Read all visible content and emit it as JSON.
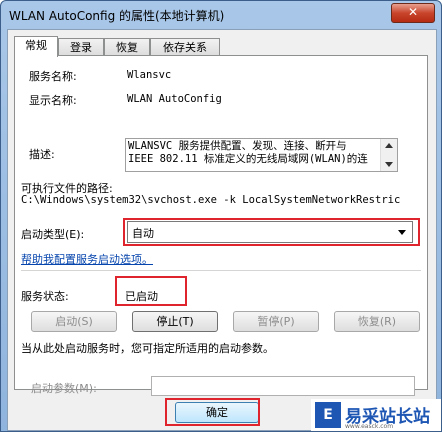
{
  "window": {
    "title": "WLAN AutoConfig 的属性(本地计算机)",
    "close_label": "✕"
  },
  "tabs": [
    {
      "label": "常规"
    },
    {
      "label": "登录"
    },
    {
      "label": "恢复"
    },
    {
      "label": "依存关系"
    }
  ],
  "general": {
    "service_name_label": "服务名称:",
    "service_name_value": "Wlansvc",
    "display_name_label": "显示名称:",
    "display_name_value": "WLAN AutoConfig",
    "description_label": "描述:",
    "description_value": "WLANSVC 服务提供配置、发现、连接、断开与\nIEEE 802.11 标准定义的无线局域网(WLAN)的连",
    "exe_path_label": "可执行文件的路径:",
    "exe_path_value": "C:\\Windows\\system32\\svchost.exe -k LocalSystemNetworkRestric",
    "startup_type_label": "启动类型(E):",
    "startup_type_value": "自动",
    "help_link": "帮助我配置服务启动选项。",
    "service_status_label": "服务状态:",
    "service_status_value": "已启动",
    "buttons": {
      "start": "启动(S)",
      "stop": "停止(T)",
      "pause": "暂停(P)",
      "resume": "恢复(R)"
    },
    "hint": "当从此处启动服务时，您可指定所适用的启动参数。",
    "start_params_label": "启动参数(M):",
    "start_params_value": ""
  },
  "footer": {
    "ok_label": "确定"
  },
  "watermark": {
    "logo": "E",
    "text": "易采站长站",
    "url": "www.easck.com"
  },
  "colors": {
    "highlight_border": "#e0242e",
    "link": "#0645ad"
  },
  "icons": [
    "close-icon",
    "scroll-up-arrow-icon",
    "scroll-down-arrow-icon",
    "dropdown-caret-icon"
  ]
}
